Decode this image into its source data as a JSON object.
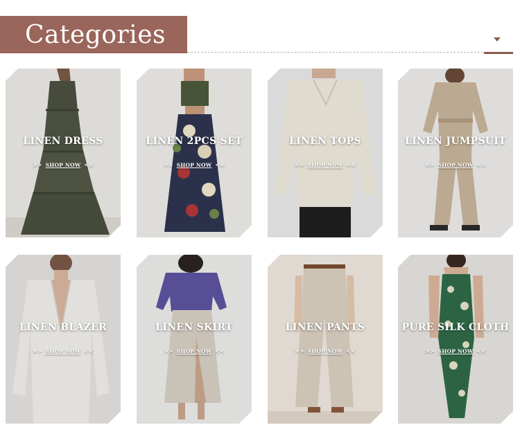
{
  "header": {
    "title": "Categories"
  },
  "categories": [
    {
      "label": "LINEN DRESS",
      "shop_now": "SHOP NOW",
      "arrow_left": ">>",
      "arrow_right": "<<"
    },
    {
      "label": "LINEN 2PCS SET",
      "shop_now": "SHOP NOW",
      "arrow_left": ">>",
      "arrow_right": "<<"
    },
    {
      "label": "LINEN TOPS",
      "shop_now": "SHOP NOW",
      "arrow_left": ">>",
      "arrow_right": "<<"
    },
    {
      "label": "LINEN JUMPSUIT",
      "shop_now": "SHOP NOW",
      "arrow_left": ">>",
      "arrow_right": "<<"
    },
    {
      "label": "LINEN BLAZER",
      "shop_now": "SHOP NOW",
      "arrow_left": ">>",
      "arrow_right": "<<"
    },
    {
      "label": "LINEN SKIRT",
      "shop_now": "SHOP NOW",
      "arrow_left": ">>",
      "arrow_right": "<<"
    },
    {
      "label": "LINEN PANTS",
      "shop_now": "SHOP NOW",
      "arrow_left": ">>",
      "arrow_right": "<<"
    },
    {
      "label": "PURE SILK CLOTH",
      "shop_now": "SHOP NOW",
      "arrow_left": ">>",
      "arrow_right": "<<"
    }
  ],
  "colors": {
    "banner": "#9a655a",
    "accent": "#8a5a50"
  },
  "icons": {
    "dropdown": "chevron-down-icon"
  }
}
